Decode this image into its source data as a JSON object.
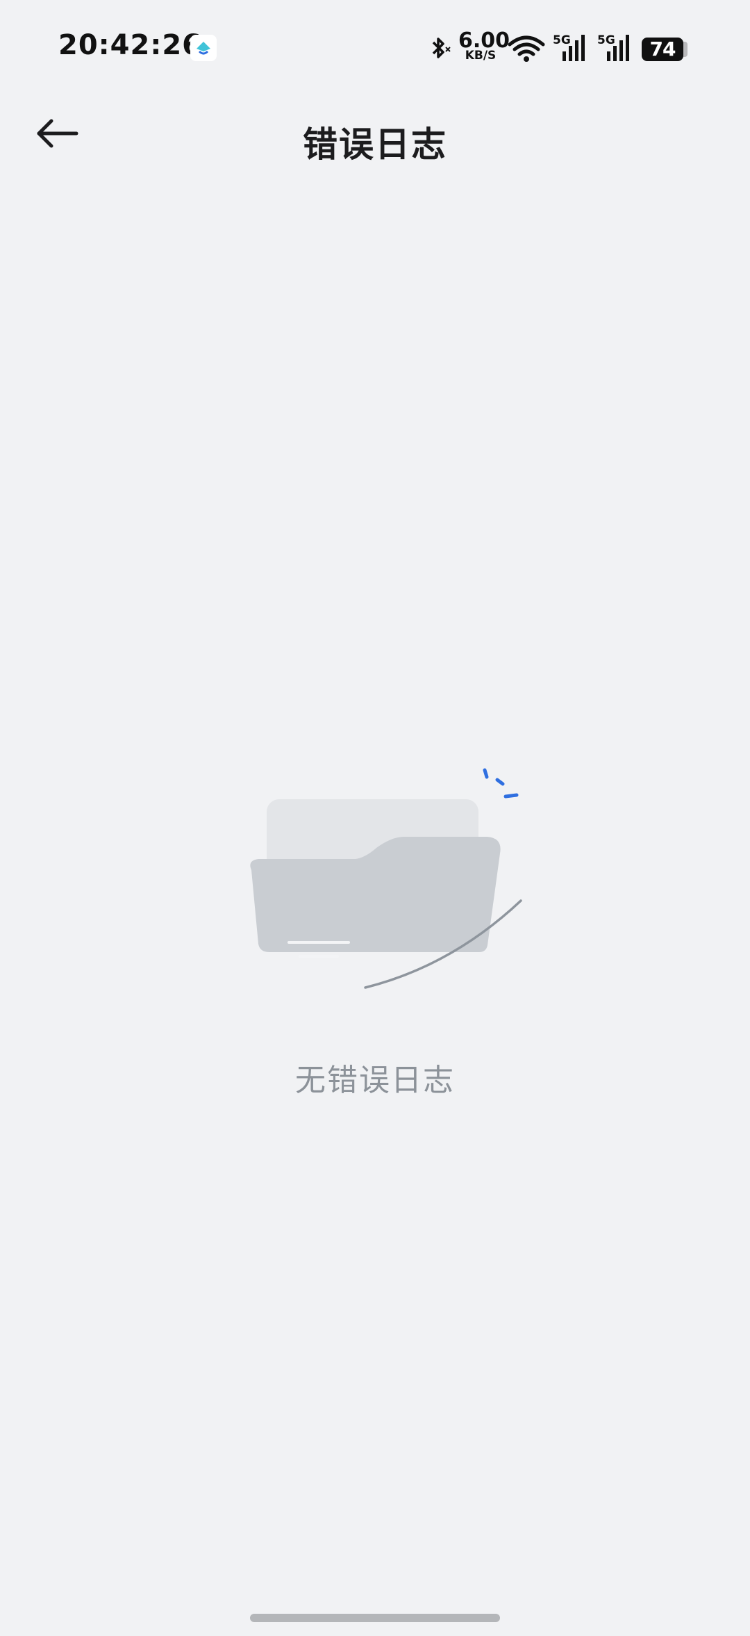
{
  "status_bar": {
    "time": "20:42:26",
    "net_speed_value": "6.00",
    "net_speed_unit": "KB/S",
    "signal_label_1": "5G",
    "signal_label_2": "5G",
    "battery_level": "74",
    "icons": [
      "app-notification-icon",
      "bluetooth-icon",
      "wifi-icon",
      "cellular-signal-icon",
      "cellular-signal-icon",
      "battery-icon"
    ]
  },
  "header": {
    "back_icon": "arrow-left-icon",
    "title": "错误日志"
  },
  "empty_state": {
    "illustration": "empty-folder-icon",
    "message": "无错误日志",
    "accent_color": "#2f6fe0"
  }
}
